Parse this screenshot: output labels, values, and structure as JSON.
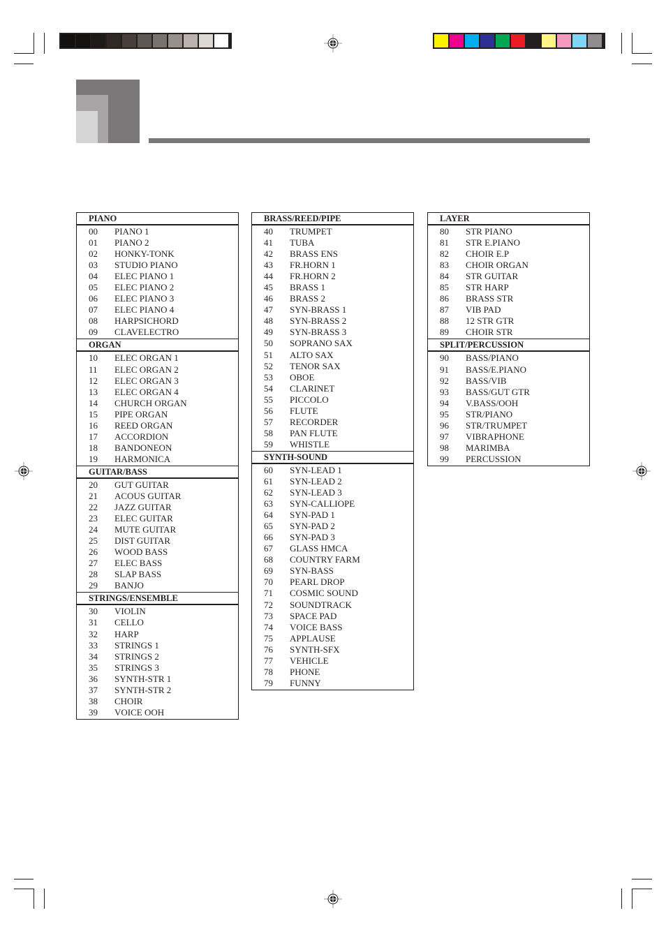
{
  "print_marks": {
    "gray_swatches": [
      "#121110",
      "#141211",
      "#1e1a18",
      "#302825",
      "#483f3b",
      "#5f5753",
      "#7a726e",
      "#98908b",
      "#bcb2ad",
      "#dcd9d4",
      "#ffffff"
    ],
    "color_swatches": [
      "#fff200",
      "#ec008c",
      "#00aeef",
      "#2e3192",
      "#00a651",
      "#ed1c24",
      "#231f20",
      "#fff685",
      "#f49ac1",
      "#7dd5f7",
      "#8e8c8c"
    ]
  },
  "header": {
    "title": ""
  },
  "tone_list": {
    "columns": [
      {
        "groups": [
          {
            "title": "PIANO",
            "items": [
              {
                "num": "00",
                "name": "PIANO 1"
              },
              {
                "num": "01",
                "name": "PIANO 2"
              },
              {
                "num": "02",
                "name": "HONKY-TONK"
              },
              {
                "num": "03",
                "name": "STUDIO PIANO"
              },
              {
                "num": "04",
                "name": "ELEC PIANO 1"
              },
              {
                "num": "05",
                "name": "ELEC PIANO 2"
              },
              {
                "num": "06",
                "name": "ELEC PIANO 3"
              },
              {
                "num": "07",
                "name": "ELEC PIANO 4"
              },
              {
                "num": "08",
                "name": "HARPSICHORD"
              },
              {
                "num": "09",
                "name": "CLAVELECTRO"
              }
            ]
          },
          {
            "title": "ORGAN",
            "items": [
              {
                "num": "10",
                "name": "ELEC ORGAN 1"
              },
              {
                "num": "11",
                "name": "ELEC ORGAN 2"
              },
              {
                "num": "12",
                "name": "ELEC ORGAN 3"
              },
              {
                "num": "13",
                "name": "ELEC ORGAN 4"
              },
              {
                "num": "14",
                "name": "CHURCH ORGAN"
              },
              {
                "num": "15",
                "name": "PIPE ORGAN"
              },
              {
                "num": "16",
                "name": "REED ORGAN"
              },
              {
                "num": "17",
                "name": "ACCORDION"
              },
              {
                "num": "18",
                "name": "BANDONEON"
              },
              {
                "num": "19",
                "name": "HARMONICA"
              }
            ]
          },
          {
            "title": "GUITAR/BASS",
            "items": [
              {
                "num": "20",
                "name": "GUT GUITAR"
              },
              {
                "num": "21",
                "name": "ACOUS GUITAR"
              },
              {
                "num": "22",
                "name": "JAZZ GUITAR"
              },
              {
                "num": "23",
                "name": "ELEC GUITAR"
              },
              {
                "num": "24",
                "name": "MUTE GUITAR"
              },
              {
                "num": "25",
                "name": "DIST GUITAR"
              },
              {
                "num": "26",
                "name": "WOOD BASS"
              },
              {
                "num": "27",
                "name": "ELEC BASS"
              },
              {
                "num": "28",
                "name": "SLAP BASS"
              },
              {
                "num": "29",
                "name": "BANJO"
              }
            ]
          },
          {
            "title": "STRINGS/ENSEMBLE",
            "items": [
              {
                "num": "30",
                "name": "VIOLIN"
              },
              {
                "num": "31",
                "name": "CELLO"
              },
              {
                "num": "32",
                "name": "HARP"
              },
              {
                "num": "33",
                "name": "STRINGS 1"
              },
              {
                "num": "34",
                "name": "STRINGS 2"
              },
              {
                "num": "35",
                "name": "STRINGS 3"
              },
              {
                "num": "36",
                "name": "SYNTH-STR 1"
              },
              {
                "num": "37",
                "name": "SYNTH-STR 2"
              },
              {
                "num": "38",
                "name": "CHOIR"
              },
              {
                "num": "39",
                "name": "VOICE OOH"
              }
            ]
          }
        ]
      },
      {
        "groups": [
          {
            "title": "BRASS/REED/PIPE",
            "items": [
              {
                "num": "40",
                "name": "TRUMPET"
              },
              {
                "num": "41",
                "name": "TUBA"
              },
              {
                "num": "42",
                "name": "BRASS ENS"
              },
              {
                "num": "43",
                "name": "FR.HORN 1"
              },
              {
                "num": "44",
                "name": "FR.HORN 2"
              },
              {
                "num": "45",
                "name": "BRASS 1"
              },
              {
                "num": "46",
                "name": "BRASS 2"
              },
              {
                "num": "47",
                "name": "SYN-BRASS 1"
              },
              {
                "num": "48",
                "name": "SYN-BRASS 2"
              },
              {
                "num": "49",
                "name": "SYN-BRASS 3"
              },
              {
                "num": "50",
                "name": "SOPRANO SAX"
              },
              {
                "num": "51",
                "name": "ALTO SAX"
              },
              {
                "num": "52",
                "name": "TENOR SAX"
              },
              {
                "num": "53",
                "name": "OBOE"
              },
              {
                "num": "54",
                "name": "CLARINET"
              },
              {
                "num": "55",
                "name": "PICCOLO"
              },
              {
                "num": "56",
                "name": "FLUTE"
              },
              {
                "num": "57",
                "name": "RECORDER"
              },
              {
                "num": "58",
                "name": "PAN FLUTE"
              },
              {
                "num": "59",
                "name": "WHISTLE"
              }
            ]
          },
          {
            "title": "SYNTH-SOUND",
            "items": [
              {
                "num": "60",
                "name": "SYN-LEAD 1"
              },
              {
                "num": "61",
                "name": "SYN-LEAD 2"
              },
              {
                "num": "62",
                "name": "SYN-LEAD 3"
              },
              {
                "num": "63",
                "name": "SYN-CALLIOPE"
              },
              {
                "num": "64",
                "name": "SYN-PAD 1"
              },
              {
                "num": "65",
                "name": "SYN-PAD 2"
              },
              {
                "num": "66",
                "name": "SYN-PAD 3"
              },
              {
                "num": "67",
                "name": "GLASS HMCA"
              },
              {
                "num": "68",
                "name": "COUNTRY FARM"
              },
              {
                "num": "69",
                "name": "SYN-BASS"
              },
              {
                "num": "70",
                "name": "PEARL DROP"
              },
              {
                "num": "71",
                "name": "COSMIC SOUND"
              },
              {
                "num": "72",
                "name": "SOUNDTRACK"
              },
              {
                "num": "73",
                "name": "SPACE PAD"
              },
              {
                "num": "74",
                "name": "VOICE BASS"
              },
              {
                "num": "75",
                "name": "APPLAUSE"
              },
              {
                "num": "76",
                "name": "SYNTH-SFX"
              },
              {
                "num": "77",
                "name": "VEHICLE"
              },
              {
                "num": "78",
                "name": "PHONE"
              },
              {
                "num": "79",
                "name": "FUNNY"
              }
            ]
          }
        ]
      },
      {
        "groups": [
          {
            "title": "LAYER",
            "items": [
              {
                "num": "80",
                "name": "STR PIANO"
              },
              {
                "num": "81",
                "name": "STR E.PIANO"
              },
              {
                "num": "82",
                "name": "CHOIR E.P"
              },
              {
                "num": "83",
                "name": "CHOIR ORGAN"
              },
              {
                "num": "84",
                "name": "STR GUITAR"
              },
              {
                "num": "85",
                "name": "STR HARP"
              },
              {
                "num": "86",
                "name": "BRASS STR"
              },
              {
                "num": "87",
                "name": "VIB PAD"
              },
              {
                "num": "88",
                "name": "12 STR GTR"
              },
              {
                "num": "89",
                "name": "CHOIR STR"
              }
            ]
          },
          {
            "title": "SPLIT/PERCUSSION",
            "items": [
              {
                "num": "90",
                "name": "BASS/PIANO"
              },
              {
                "num": "91",
                "name": "BASS/E.PIANO"
              },
              {
                "num": "92",
                "name": "BASS/VIB"
              },
              {
                "num": "93",
                "name": "BASS/GUT GTR"
              },
              {
                "num": "94",
                "name": "V.BASS/OOH"
              },
              {
                "num": "95",
                "name": "STR/PIANO"
              },
              {
                "num": "96",
                "name": "STR/TRUMPET"
              },
              {
                "num": "97",
                "name": "VIBRAPHONE"
              },
              {
                "num": "98",
                "name": "MARIMBA"
              },
              {
                "num": "99",
                "name": "PERCUSSION"
              }
            ]
          }
        ]
      }
    ]
  }
}
